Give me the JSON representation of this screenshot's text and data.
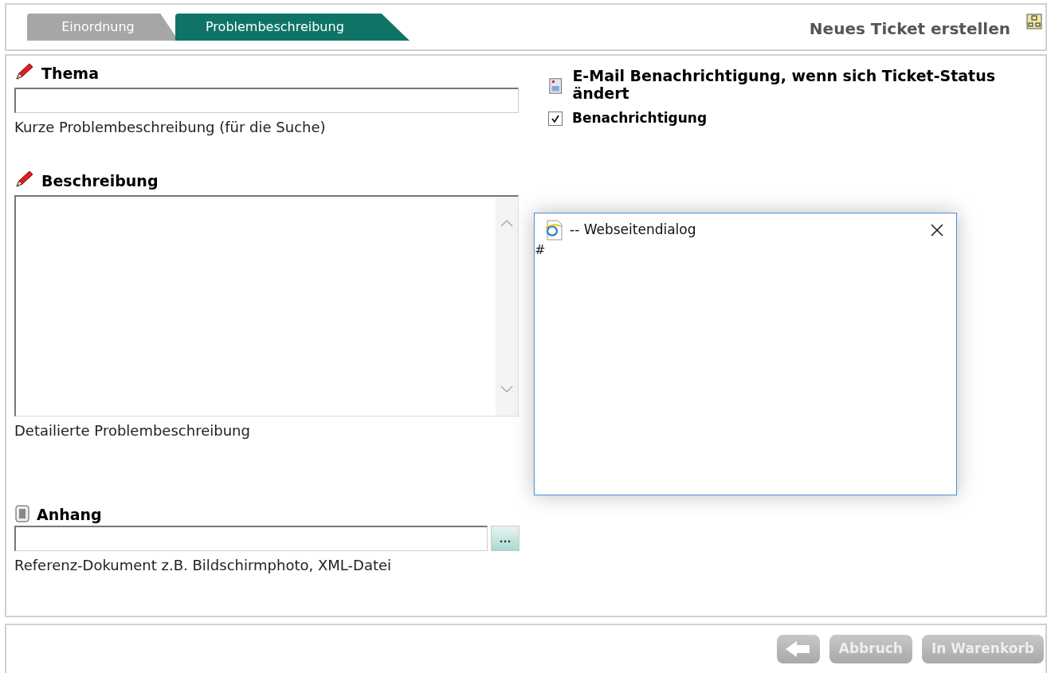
{
  "tabs": [
    {
      "label": "Einordnung",
      "selected": false
    },
    {
      "label": "Problembeschreibung",
      "selected": true
    }
  ],
  "title": "Neues Ticket erstellen",
  "fields": [
    {
      "kind": "text",
      "label": "Thema",
      "hint": "Kurze Problembeschreibung (für die Suche)"
    },
    {
      "kind": "textarea",
      "label": "Beschreibung",
      "hint": "Detailierte Problembeschreibung"
    },
    {
      "kind": "file",
      "label": "Anhang",
      "hint": "Referenz-Dokument z.B. Bildschirmphoto, XML-Datei",
      "browse": "..."
    }
  ],
  "notification": {
    "heading": "E-Mail Benachrichtigung, wenn sich Ticket-Status ändert",
    "option": "Benachrichtigung",
    "checked": true
  },
  "dialog": {
    "title": "-- Webseitendialog",
    "body": "#"
  },
  "buttons": [
    {
      "kind": "back",
      "disabled": true
    },
    {
      "kind": "text",
      "label": "Abbruch",
      "disabled": true
    },
    {
      "kind": "text",
      "label": "In Warenkorb",
      "disabled": true
    }
  ]
}
